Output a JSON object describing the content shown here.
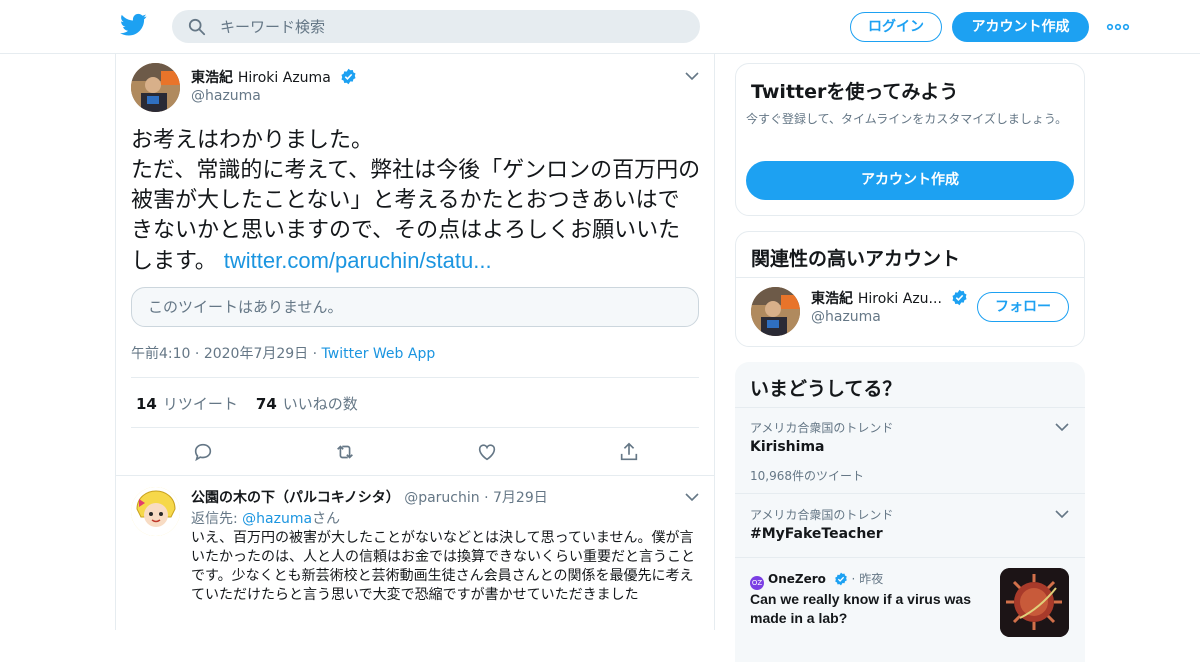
{
  "header": {
    "search_placeholder": "キーワード検索",
    "login_label": "ログイン",
    "signup_label": "アカウント作成"
  },
  "tweet": {
    "author_name_jp": "東浩紀",
    "author_name_en": "Hiroki Azuma",
    "handle": "@hazuma",
    "text": "お考えはわかりました。\nただ、常識的に考えて、弊社は今後「ゲンロンの百万円の被害が大したことない」と考えるかたとおつきあいはできないかと思いますので、その点はよろしくお願いいたします。 ",
    "link": "twitter.com/paruchin/statu...",
    "quote_unavailable": "このツイートはありません。",
    "time": "午前4:10",
    "date": "2020年7月29日",
    "source": "Twitter Web App",
    "retweet_count": "14",
    "retweet_label": "リツイート",
    "like_count": "74",
    "like_label": "いいねの数"
  },
  "reply": {
    "author_name": "公園の木の下（パルコキノシタ）",
    "handle": "@paruchin",
    "date": "7月29日",
    "reply_to_prefix": "返信先: ",
    "reply_to_handle": "@hazuma",
    "reply_to_suffix": "さん",
    "text": "いえ、百万円の被害が大したことがないなどとは決して思っていません。僕が言いたかったのは、人と人の信頼はお金では換算できないくらい重要だと言うことです。少なくとも新芸術校と芸術動画生徒さん会員さんとの関係を最優先に考えていただけたらと言う思いで大変で恐縮ですが書かせていただきました"
  },
  "sidebar": {
    "try_title": "Twitterを使ってみよう",
    "try_text": "今すぐ登録して、タイムラインをカスタマイズしましょう。",
    "try_button": "アカウント作成",
    "related_title": "関連性の高いアカウント",
    "related_name_jp": "東浩紀",
    "related_name_en": "Hiroki Azu...",
    "related_handle": "@hazuma",
    "follow_label": "フォロー",
    "trends_title": "いまどうしてる？",
    "trends": [
      {
        "context": "アメリカ合衆国のトレンド",
        "name": "Kirishima",
        "count": "10,968件のツイート"
      },
      {
        "context": "アメリカ合衆国のトレンド",
        "name": "#MyFakeTeacher"
      }
    ],
    "news_source": "OneZero",
    "news_time": "昨夜",
    "news_title": "Can we really know if a virus was made in a lab?"
  },
  "colors": {
    "brand": "#1da1f2",
    "link": "#1b95e0",
    "muted": "#657786",
    "border": "#e6ecf0"
  }
}
